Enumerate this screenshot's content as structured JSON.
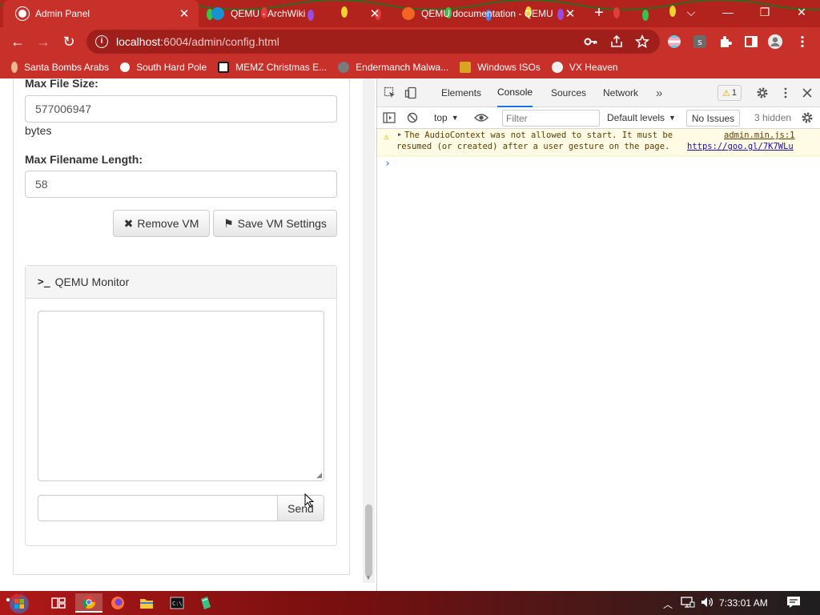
{
  "browser": {
    "tabs": [
      {
        "title": "Admin Panel",
        "active": true,
        "favicon_color": "#ffffff"
      },
      {
        "title": "QEMU - ArchWiki",
        "active": false,
        "favicon_color": "#1793d1"
      },
      {
        "title": "QEMU documentation - QEMU",
        "active": false,
        "favicon_color": "#f26522"
      }
    ],
    "close_glyph": "✕",
    "new_tab_glyph": "+",
    "window_controls": {
      "dropdown": "⌵",
      "minimize": "—",
      "restore": "❐",
      "close": "✕"
    },
    "address": {
      "host": "localhost",
      "rest": ":6004/admin/config.html"
    },
    "nav": {
      "back": "←",
      "forward": "→",
      "reload": "↻"
    },
    "toolbar_icons": [
      "key-icon",
      "share-icon",
      "star-icon",
      "profile-pride-icon",
      "extension-s-icon",
      "puzzle-icon",
      "sidebar-icon",
      "account-icon",
      "menu-dots-icon"
    ],
    "bookmarks": [
      {
        "label": "Santa Bombs Arabs",
        "icon": "bomb-icon"
      },
      {
        "label": "South Hard Pole",
        "icon": "snowman-icon"
      },
      {
        "label": "MEMZ Christmas E...",
        "icon": "memz-icon"
      },
      {
        "label": "Endermanch Malwa...",
        "icon": "enderman-icon"
      },
      {
        "label": "Windows ISOs",
        "icon": "windows-icon"
      },
      {
        "label": "VX Heaven",
        "icon": "vx-icon"
      }
    ]
  },
  "page": {
    "max_file_size": {
      "label": "Max File Size:",
      "value": "577006947",
      "unit": "bytes"
    },
    "max_filename_length": {
      "label": "Max Filename Length:",
      "value": "58"
    },
    "remove_vm": {
      "glyph": "✖",
      "label": "Remove VM"
    },
    "save_vm": {
      "glyph": "⚑",
      "label": "Save VM Settings"
    },
    "monitor": {
      "glyph": ">_",
      "title": "QEMU Monitor",
      "send": "Send"
    }
  },
  "devtools": {
    "tabs": [
      "Elements",
      "Console",
      "Sources",
      "Network"
    ],
    "active_tab": "Console",
    "more": "»",
    "warning_count": "1",
    "context": "top",
    "filter_placeholder": "Filter",
    "levels": "Default levels",
    "issues": "No Issues",
    "hidden": "3 hidden",
    "message": {
      "line1": "The AudioContext was not allowed to start. It must be",
      "line2": "resumed (or created) after a user gesture on the page.",
      "source": "admin.min.js:1",
      "link": "https://goo.gl/7K7WLu"
    },
    "prompt": "›"
  },
  "taskbar": {
    "clock": "7:33:01 AM",
    "apps": [
      "chrome-icon",
      "firefox-icon",
      "explorer-icon",
      "cmd-icon",
      "notepad-icon"
    ]
  },
  "colors": {
    "tab_strip": "#b3231e",
    "toolbar": "#c8302a",
    "accent": "#1a73e8",
    "warning_bg": "#fffbe5"
  }
}
